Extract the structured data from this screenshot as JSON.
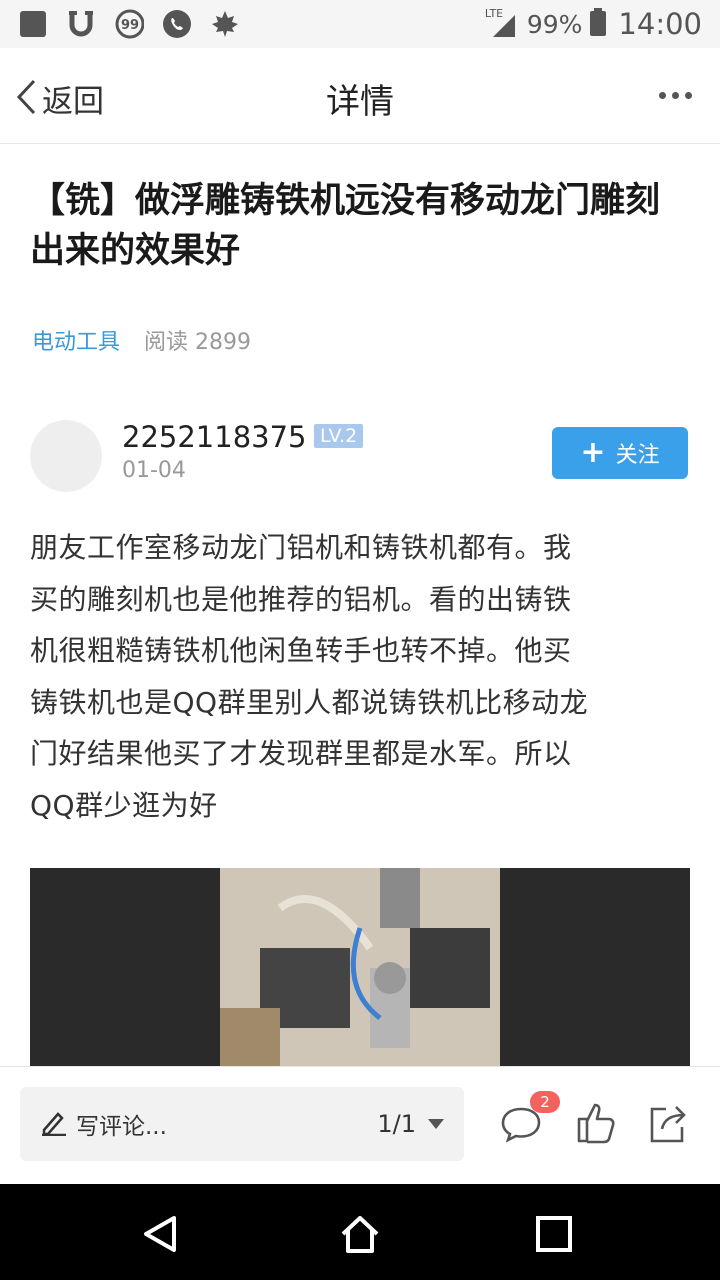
{
  "status_bar": {
    "left_icons": [
      "app-square-icon",
      "u-icon",
      "99-icon",
      "phone-icon",
      "leaf-icon"
    ],
    "badge_99": "99",
    "network": "LTE",
    "battery_percent": "99%",
    "time": "14:00"
  },
  "nav": {
    "back_label": "返回",
    "title": "详情"
  },
  "article": {
    "title": "【铣】做浮雕铸铁机远没有移动龙门雕刻出来的效果好",
    "category": "电动工具",
    "reads": "阅读 2899",
    "author": {
      "name": "2252118375",
      "level": "LV.2",
      "date": "01-04",
      "follow_label": "关注"
    },
    "body_lines": [
      "朋友工作室移动龙门铝机和铸铁机都有。我",
      "买的雕刻机也是他推荐的铝机。看的出铸铁",
      "机很粗糙铸铁机他闲鱼转手也转不掉。他买",
      "铸铁机也是QQ群里别人都说铸铁机比移动龙",
      "门好结果他买了才发现群里都是水军。所以",
      "QQ群少逛为好"
    ]
  },
  "action_bar": {
    "comment_placeholder": "写评论...",
    "page_indicator": "1/1",
    "comment_count": "2"
  },
  "colors": {
    "accent": "#3aa0ea",
    "category": "#3a9ad9",
    "badge": "#f3625c",
    "level_badge": "#a9c8ee"
  }
}
